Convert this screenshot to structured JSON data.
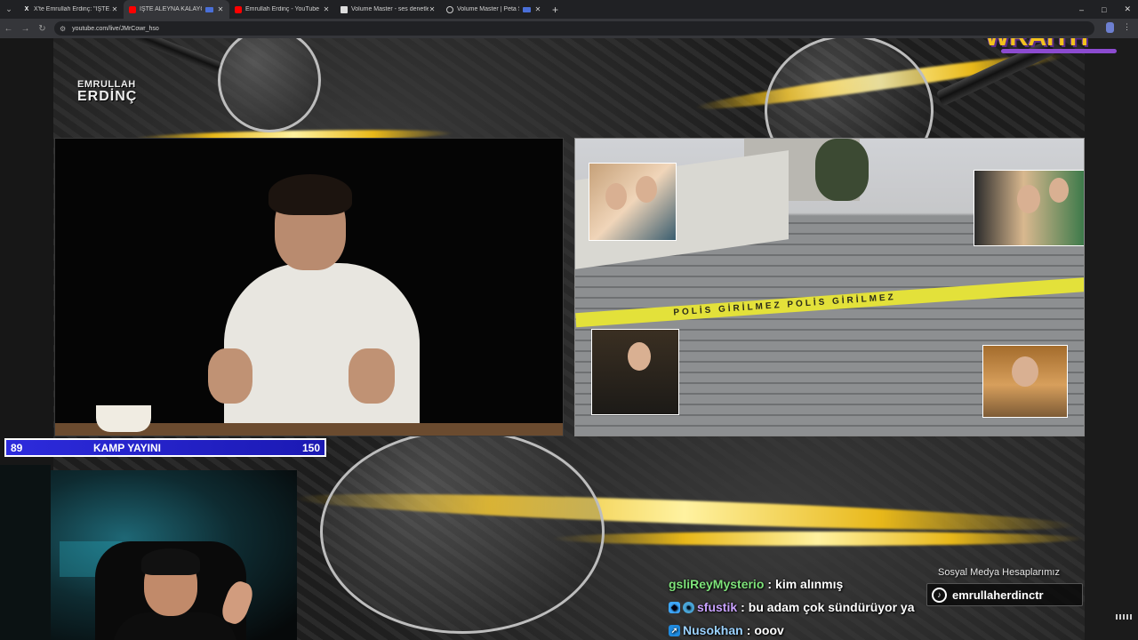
{
  "browser": {
    "tabs": [
      {
        "icon": "x-icon",
        "title": "X'te Emrullah Erdinç: \"İŞTE ALEYNA",
        "active": false
      },
      {
        "icon": "youtube-icon",
        "title": "İŞTE ALEYNA KALAYCIOĞLU",
        "active": true
      },
      {
        "icon": "youtube-icon",
        "title": "Emrullah Erdinç - YouTube",
        "active": false
      },
      {
        "icon": "doc-icon",
        "title": "Volume Master - ses denetleyicisi",
        "active": false
      },
      {
        "icon": "loading-icon",
        "title": "Volume Master | Peta Sittek",
        "active": false
      }
    ],
    "new_tab_label": "+",
    "url": "youtube.com/live/JMrCowr_hso",
    "window_controls": [
      "–",
      "□",
      "✕"
    ]
  },
  "overlay": {
    "brand_line1": "EMRULLAH",
    "brand_line2": "ERDİNÇ",
    "watermark": "WRAITH",
    "crime_tape_text": "POLİS GİRİLMEZ POLİS GİRİLMEZ",
    "camp_bar": {
      "left_value": "89",
      "title": "KAMP YAYINI",
      "right_value": "150"
    },
    "social": {
      "label": "Sosyal Medya Hesaplarımız",
      "handle": "emrullaherdinctr"
    }
  },
  "chat": [
    {
      "user": "gsliReyMysterio",
      "message": "kim alınmış",
      "color": "#7ee37a",
      "badges": []
    },
    {
      "user": "sfustik",
      "message": "bu adam çok sündürüyor ya",
      "color": "#c9a2ff",
      "badges": [
        "prime-icon",
        "sub-icon"
      ]
    },
    {
      "user": "Nusokhan",
      "message": "ooov",
      "color": "#9bd2ff",
      "badges": [
        "arrow-badge-icon"
      ]
    }
  ],
  "colors": {
    "camp_bar_bg": "#2d2bdc",
    "watermark": "#f3c21c",
    "tape": "#e3e13a",
    "browser_bg": "#202124"
  }
}
